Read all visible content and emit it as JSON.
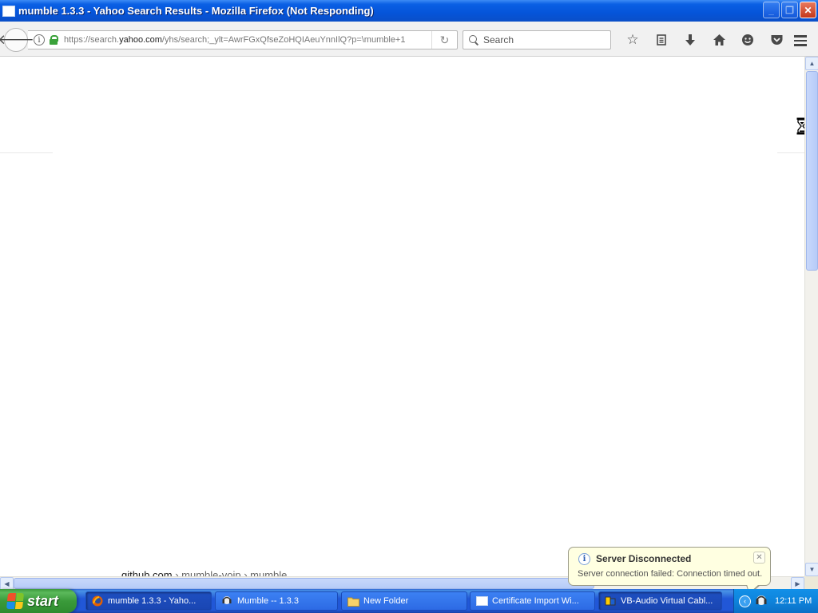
{
  "window": {
    "title": "mumble 1.3.3 - Yahoo Search Results - Mozilla Firefox (Not Responding)",
    "minimize": "_",
    "maximize": "❐",
    "close": "✕"
  },
  "navbar": {
    "url_prefix": "https://search.",
    "url_host": "yahoo.com",
    "url_rest": "/yhs/search;_ylt=AwrFGxQfseZoHQIAeuYnnIlQ?p=\\mumble+1",
    "search_placeholder": "Search",
    "icons": [
      "back-icon",
      "info-icon",
      "lock-icon",
      "reload-icon",
      "search-icon",
      "bookmark-star-icon",
      "reading-list-icon",
      "download-icon",
      "home-icon",
      "smiley-icon",
      "pocket-icon",
      "menu-icon"
    ]
  },
  "content": {
    "peek_host": "github.com",
    "peek_sep1": " › ",
    "peek_path1": "mumble-voip",
    "peek_sep2": " › ",
    "peek_path2": "mumble"
  },
  "notification": {
    "title": "Server Disconnected",
    "message": "Server connection failed: Connection timed out.",
    "info_glyph": "i",
    "close_glyph": "✕"
  },
  "taskbar": {
    "start_label": "start",
    "tasks": [
      {
        "label": "mumble 1.3.3 - Yaho...",
        "icon": "firefox-icon"
      },
      {
        "label": "Mumble -- 1.3.3",
        "icon": "mumble-icon"
      },
      {
        "label": "New Folder",
        "icon": "folder-icon"
      },
      {
        "label": "Certificate Import Wi...",
        "icon": "window-icon"
      },
      {
        "label": "VB-Audio Virtual Cabl...",
        "icon": "vb-audio-icon"
      }
    ],
    "clock": "12:11 PM"
  },
  "colors": {
    "titlebar": "#0554d9",
    "taskbar": "#2157d7",
    "start": "#3a9a3a",
    "balloon": "#ffffe1",
    "lock": "#3aa23a"
  }
}
